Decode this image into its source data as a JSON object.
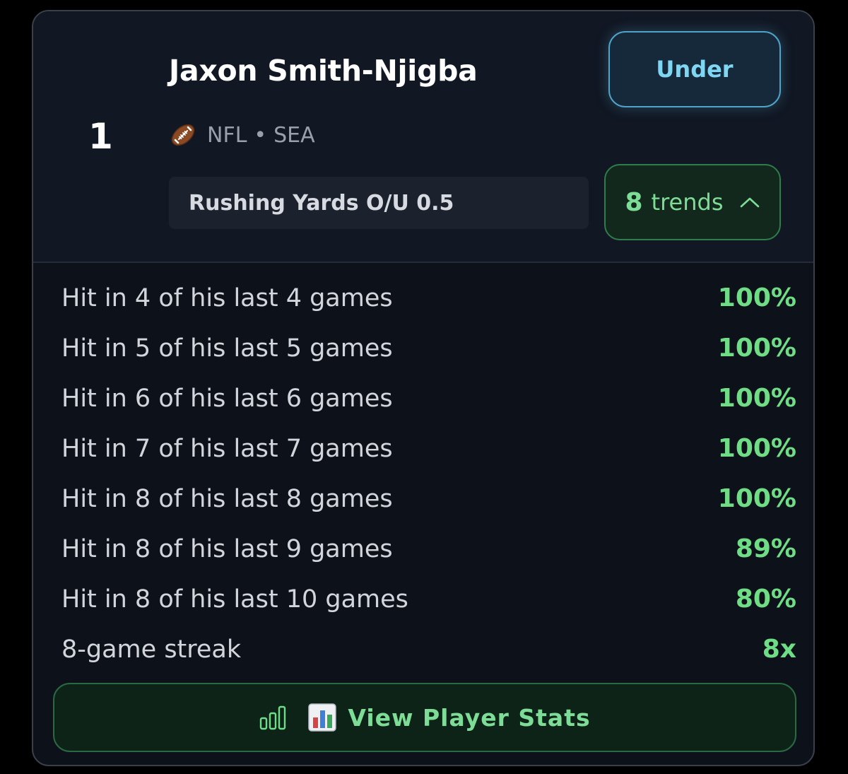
{
  "card": {
    "rank": "1",
    "player_name": "Jaxon Smith-Njigba",
    "league": "NFL",
    "separator": "•",
    "team": "SEA",
    "prop_label": "Rushing Yards O/U 0.5",
    "pick_button_label": "Under",
    "trends_count": "8",
    "trends_label": "trends",
    "football_icon": "football-icon",
    "chevron_icon": "chevron-up-icon"
  },
  "trends": [
    {
      "text": "Hit in 4 of his last 4 games",
      "value": "100%"
    },
    {
      "text": "Hit in 5 of his last 5 games",
      "value": "100%"
    },
    {
      "text": "Hit in 6 of his last 6 games",
      "value": "100%"
    },
    {
      "text": "Hit in 7 of his last 7 games",
      "value": "100%"
    },
    {
      "text": "Hit in 8 of his last 8 games",
      "value": "100%"
    },
    {
      "text": "Hit in 8 of his last 9 games",
      "value": "89%"
    },
    {
      "text": "Hit in 8 of his last 10 games",
      "value": "80%"
    },
    {
      "text": "8-game streak",
      "value": "8x"
    }
  ],
  "stats_button": {
    "label": "View Player Stats",
    "icons": [
      "bar-chart-outline-icon",
      "bar-chart-emoji-icon"
    ]
  },
  "colors": {
    "background": "#000000",
    "card": "#0d111a",
    "accent_green": "#6fdc86",
    "accent_blue": "#7fd6f2"
  }
}
